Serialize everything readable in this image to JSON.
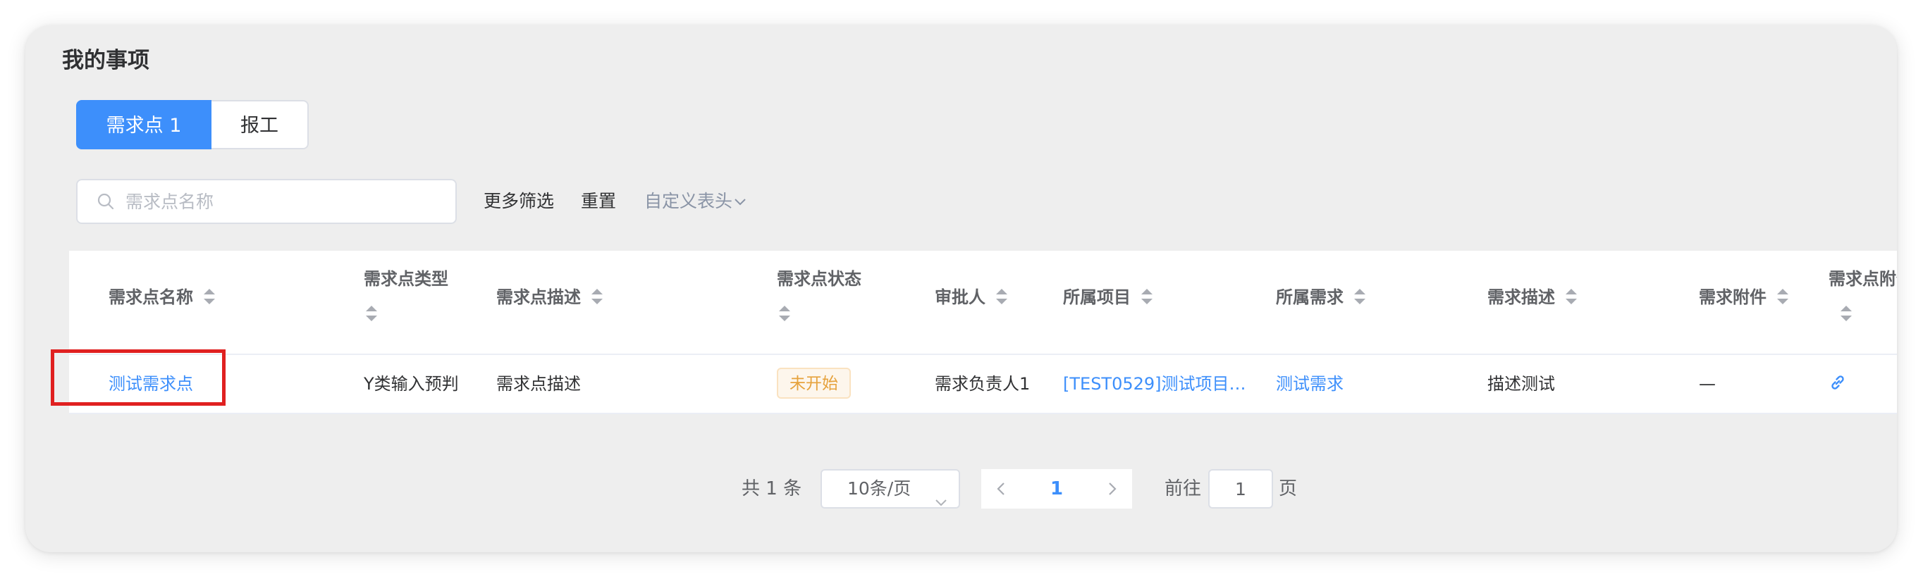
{
  "panel": {
    "title": "我的事项"
  },
  "tabs": [
    {
      "label": "需求点 1",
      "active": true
    },
    {
      "label": "报工",
      "active": false
    }
  ],
  "filters": {
    "search_placeholder": "需求点名称",
    "more_filters": "更多筛选",
    "reset": "重置",
    "custom_header": "自定义表头"
  },
  "table": {
    "columns": [
      "需求点名称",
      "需求点类型",
      "需求点描述",
      "需求点状态",
      "审批人",
      "所属项目",
      "所属需求",
      "需求描述",
      "需求附件",
      "需求点附件"
    ],
    "rows": [
      {
        "name": "测试需求点",
        "type": "Y类输入预判",
        "description": "需求点描述",
        "status": "未开始",
        "approver": "需求负责人1",
        "project": "[TEST0529]测试项目0...",
        "requirement": "测试需求",
        "requirement_desc": "描述测试",
        "requirement_attachment": "—",
        "attachment_icon": "link-icon"
      }
    ]
  },
  "pagination": {
    "total_text": "共 1 条",
    "page_size": "10条/页",
    "current_page": "1",
    "goto_label": "前往",
    "goto_value": "1",
    "page_unit": "页"
  },
  "colors": {
    "primary": "#3d8ffb",
    "status_warning": "#e6a23c",
    "highlight": "#e02020"
  }
}
